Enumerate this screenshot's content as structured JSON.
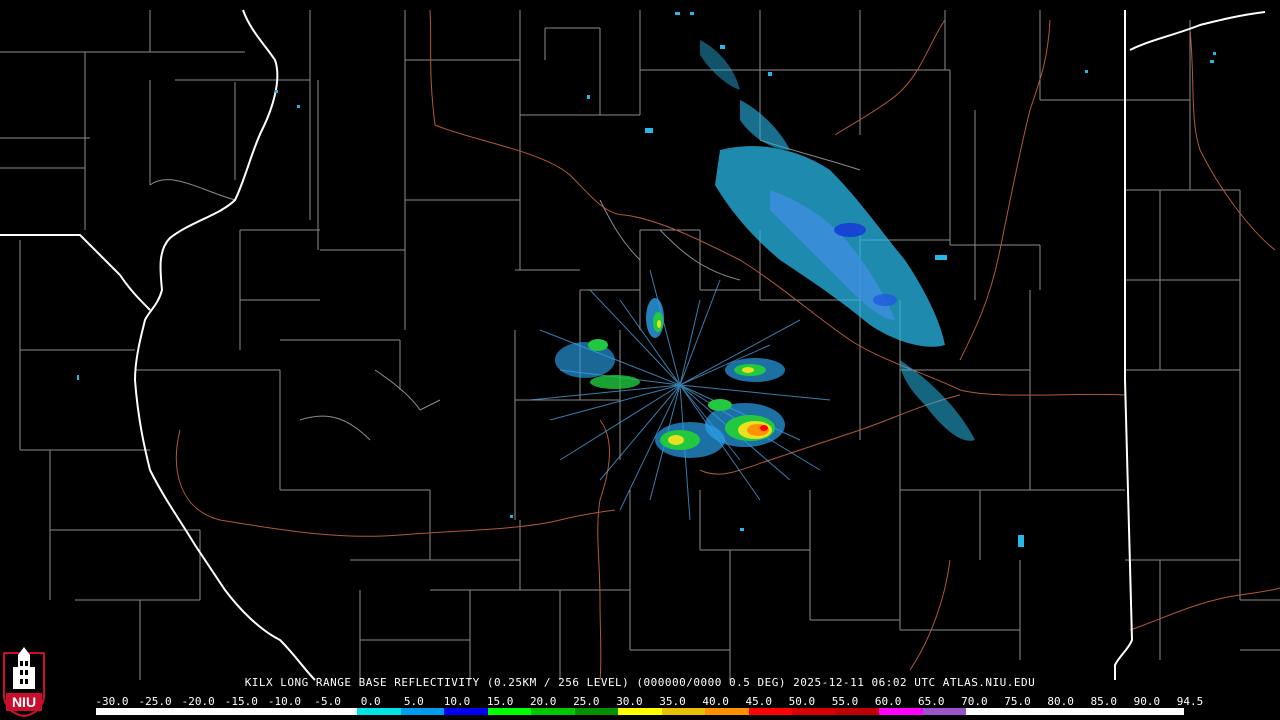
{
  "title": "KILX LONG RANGE BASE REFLECTIVITY (0.25KM / 256 LEVEL) (000000/0000 0.5 DEG) 2025-12-11 06:02 UTC  ATLAS.NIU.EDU",
  "legend": {
    "ticks": [
      "-30.0",
      "-25.0",
      "-20.0",
      "-15.0",
      "-10.0",
      "-5.0",
      "0.0",
      "5.0",
      "10.0",
      "15.0",
      "20.0",
      "25.0",
      "30.0",
      "35.0",
      "40.0",
      "45.0",
      "50.0",
      "55.0",
      "60.0",
      "65.0",
      "70.0",
      "75.0",
      "80.0",
      "85.0",
      "90.0",
      "94.5"
    ],
    "colors": [
      "#000000",
      "#000000",
      "#000000",
      "#000000",
      "#000000",
      "#000000",
      "#00e4e4",
      "#009cf0",
      "#0000f0",
      "#00ff00",
      "#00c800",
      "#009000",
      "#ffff00",
      "#e7c000",
      "#ff9000",
      "#ff0000",
      "#d60000",
      "#c00000",
      "#ff00ff",
      "#9955c9",
      "#ffffff",
      "#ffffff",
      "#ffffff",
      "#ffffff",
      "#ffffff"
    ]
  },
  "logo": {
    "text": "NIU",
    "colors": {
      "red": "#c8102e",
      "white": "#ffffff",
      "black": "#000000"
    }
  },
  "map_colors": {
    "county": "#8c8c8c",
    "state": "#ffffff",
    "river": "#b05a3a"
  }
}
